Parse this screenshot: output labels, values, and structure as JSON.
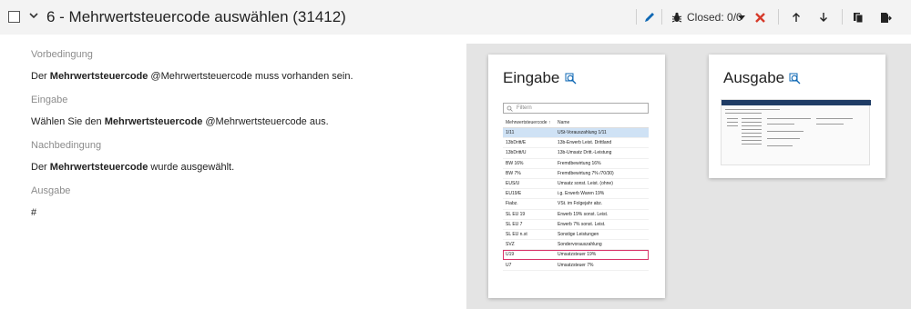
{
  "header": {
    "title": "6 - Mehrwertsteuercode auswählen (31412)",
    "closed_label": "Closed: 0/0"
  },
  "colors": {
    "accent": "#0f68b4",
    "danger": "#d63a2a",
    "highlight": "#d9346a",
    "selected_row": "#cfe2f5"
  },
  "sections": [
    {
      "label": "Vorbedingung",
      "pre": "Der ",
      "bold": "Mehrwertsteuercode",
      "post": " @Mehrwertsteuercode muss vorhanden sein."
    },
    {
      "label": "Eingabe",
      "pre": "Wählen Sie den ",
      "bold": "Mehrwertsteuercode",
      "post": " @Mehrwertsteuercode aus."
    },
    {
      "label": "Nachbedingung",
      "pre": "Der ",
      "bold": "Mehrwertsteuercode",
      "post": " wurde ausgewählt."
    },
    {
      "label": "Ausgabe",
      "pre": "#",
      "bold": "",
      "post": ""
    }
  ],
  "eingabe": {
    "title": "Eingabe",
    "filter_placeholder": "Filtern",
    "col1": "Mehrwertsteuercode ↑",
    "col2": "Name",
    "rows": [
      [
        "1/11",
        "USt-Vorauszahlung 1/11"
      ],
      [
        "13bDritt/E",
        "13b-Erwerb Leist. Drittland"
      ],
      [
        "13bDritt/U",
        "13b-Umsatz Dritt.-Leistung"
      ],
      [
        "BW 16%",
        "Fremdbewirtung 16%"
      ],
      [
        "BW 7%",
        "Fremdbewirtung 7% /70/30)"
      ],
      [
        "EUS/U",
        "Umsatz sonst. Leist. (ohne)"
      ],
      [
        "EU19/E",
        "i.g. Erwerb Waren 19%"
      ],
      [
        "Fiabz.",
        "VSt. im Folgejahr abz."
      ],
      [
        "SL EU 19",
        "Erwerb 19% sonst. Leist."
      ],
      [
        "SL EU 7",
        "Erwerb 7% sonst. Leist."
      ],
      [
        "SL EU n.st",
        "Sonstige Leistungen"
      ],
      [
        "SVZ",
        "Sondervorauszahlung"
      ],
      [
        "U19",
        "Umsatzsteuer 19%"
      ],
      [
        "U7",
        "Umsatzsteuer 7%"
      ]
    ]
  },
  "ausgabe": {
    "title": "Ausgabe"
  }
}
